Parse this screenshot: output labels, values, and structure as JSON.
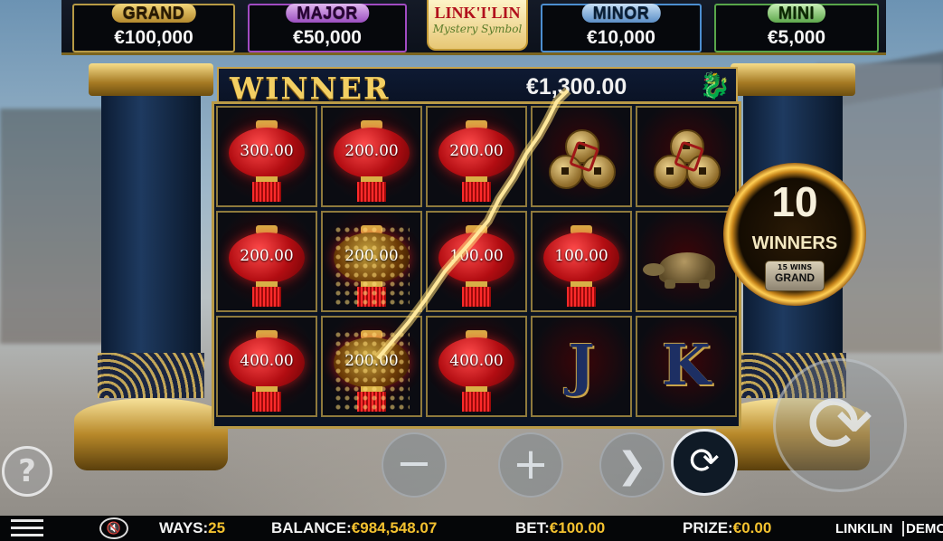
{
  "jackpots": [
    {
      "label": "GRAND",
      "value": "€100,000"
    },
    {
      "label": "MAJOR",
      "value": "€50,000"
    },
    {
      "label": "MINOR",
      "value": "€10,000"
    },
    {
      "label": "MINI",
      "value": "€5,000"
    }
  ],
  "logo": {
    "title": "LINK'I'LIN",
    "subtitle": "Mystery Symbol"
  },
  "winner": {
    "label": "WINNER",
    "amount": "€1,300.00"
  },
  "grid": [
    [
      "300.00",
      "200.00",
      "200.00",
      "coins",
      "coins"
    ],
    [
      "200.00",
      "200.00",
      "100.00",
      "100.00",
      "turtle"
    ],
    [
      "400.00",
      "200.00",
      "400.00",
      "J",
      "K"
    ]
  ],
  "medallion": {
    "count": "10",
    "label": "WINNERS",
    "badge_top": "15 WINS",
    "badge_bottom": "GRAND"
  },
  "controls": {
    "minus": "−",
    "plus": "+",
    "next": "❯",
    "autoplay": "⟳",
    "spin": "⟳",
    "help": "?"
  },
  "status": {
    "ways_label": "WAYS:",
    "ways_value": "25",
    "balance_label": "BALANCE:",
    "balance_value": "€984,548.07",
    "bet_label": "BET:",
    "bet_value": "€100.00",
    "prize_label": "PRIZE:",
    "prize_value": "€0.00",
    "game_name": "LINKILIN",
    "mode": "DEMO"
  },
  "icons": {
    "menu": "menu-icon",
    "sound": "mute-icon",
    "dragon": "dragon-icon"
  },
  "colors": {
    "accent": "#f3c12f",
    "lantern": "#c8121a",
    "frame": "#b99a46"
  }
}
